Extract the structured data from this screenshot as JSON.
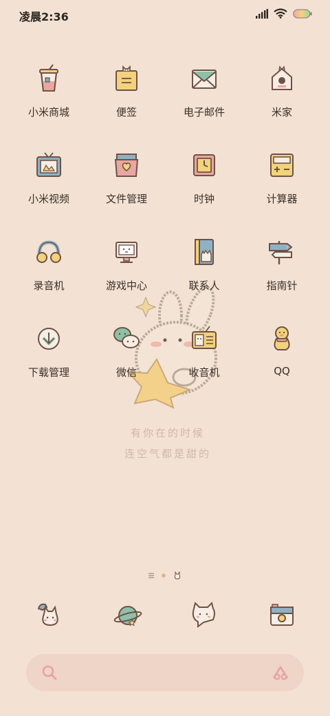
{
  "status": {
    "time": "凌晨2:36",
    "battery_color": "#9ed39a"
  },
  "apps": [
    {
      "label": "小米商城",
      "icon": "drink-cup-icon"
    },
    {
      "label": "便签",
      "icon": "sticky-note-icon"
    },
    {
      "label": "电子邮件",
      "icon": "envelope-icon"
    },
    {
      "label": "米家",
      "icon": "birdhouse-icon"
    },
    {
      "label": "小米视频",
      "icon": "tv-icon"
    },
    {
      "label": "文件管理",
      "icon": "folder-heart-icon"
    },
    {
      "label": "时钟",
      "icon": "clock-icon"
    },
    {
      "label": "计算器",
      "icon": "calculator-icon"
    },
    {
      "label": "录音机",
      "icon": "headphones-icon"
    },
    {
      "label": "游戏中心",
      "icon": "monitor-icon"
    },
    {
      "label": "联系人",
      "icon": "contact-book-icon"
    },
    {
      "label": "指南针",
      "icon": "signpost-icon"
    },
    {
      "label": "下载管理",
      "icon": "download-icon"
    },
    {
      "label": "微信",
      "icon": "chat-bubbles-icon"
    },
    {
      "label": "收音机",
      "icon": "radio-icon"
    },
    {
      "label": "QQ",
      "icon": "duck-icon"
    }
  ],
  "wallpaper": {
    "line1": "有你在的时候",
    "line2": "连空气都是甜的"
  },
  "dock": [
    {
      "icon": "phone-bunny-icon"
    },
    {
      "icon": "planet-browser-icon"
    },
    {
      "icon": "bunny-message-icon"
    },
    {
      "icon": "camera-icon"
    }
  ],
  "search": {
    "left_icon": "search-icon",
    "right_icon": "assistant-icon"
  },
  "colors": {
    "background": "#f3e2d3",
    "search_bg": "#efd4c8",
    "accent_pink": "#e8a2a0",
    "accent_yellow": "#f2d27c",
    "accent_blue": "#8fb1c3",
    "outline": "#6e5246"
  }
}
